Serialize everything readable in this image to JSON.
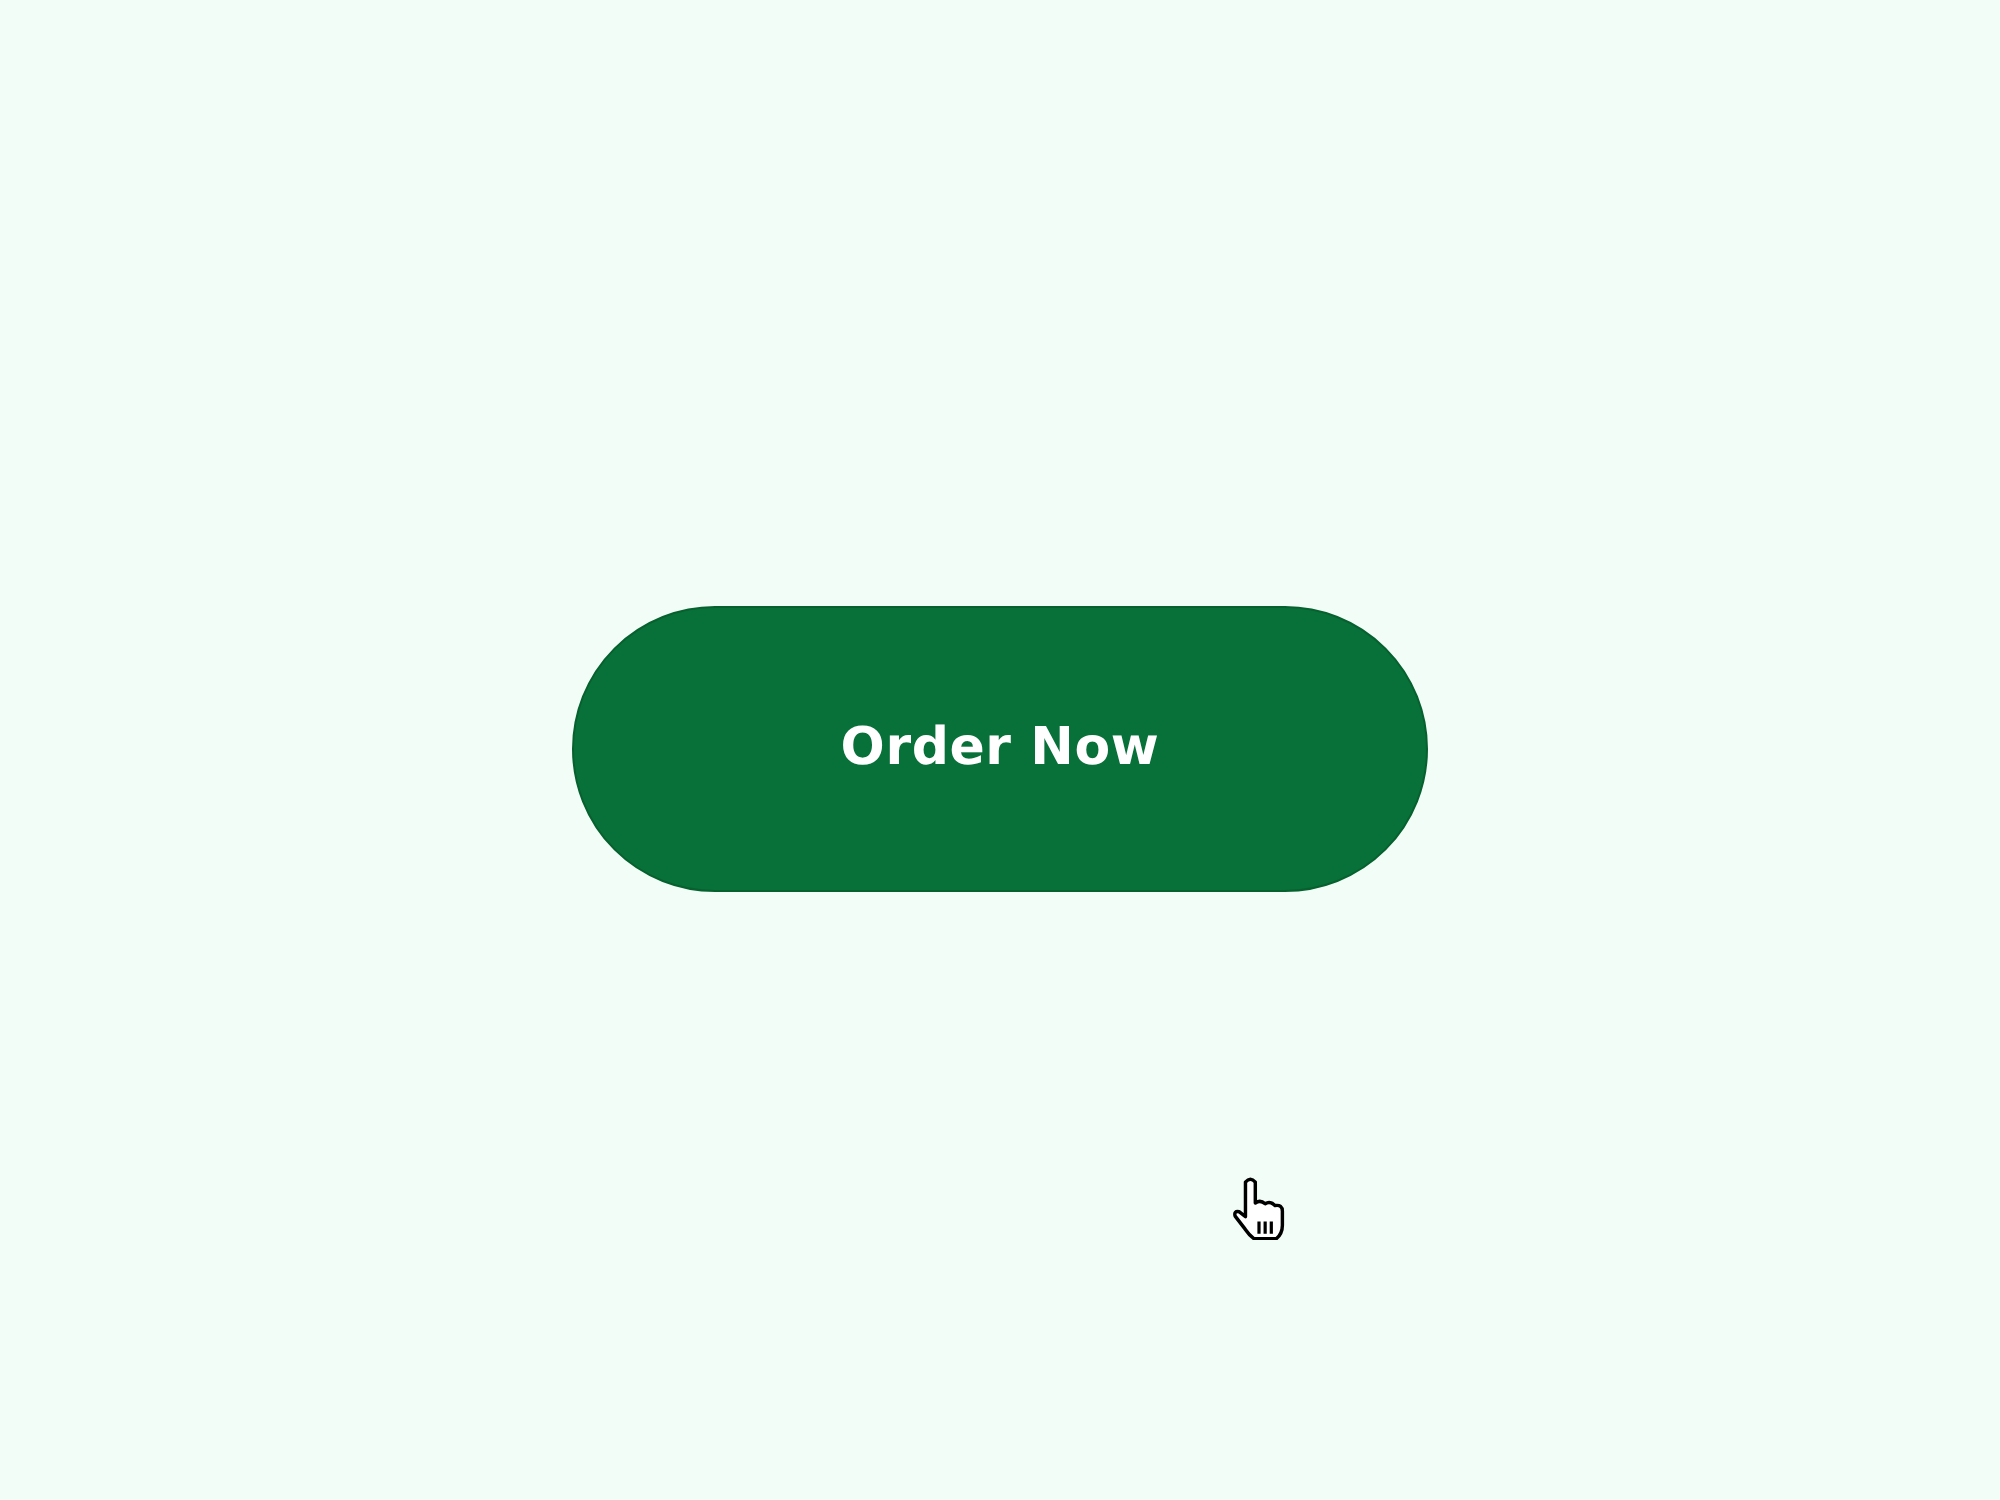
{
  "button": {
    "label": "Order Now"
  }
}
